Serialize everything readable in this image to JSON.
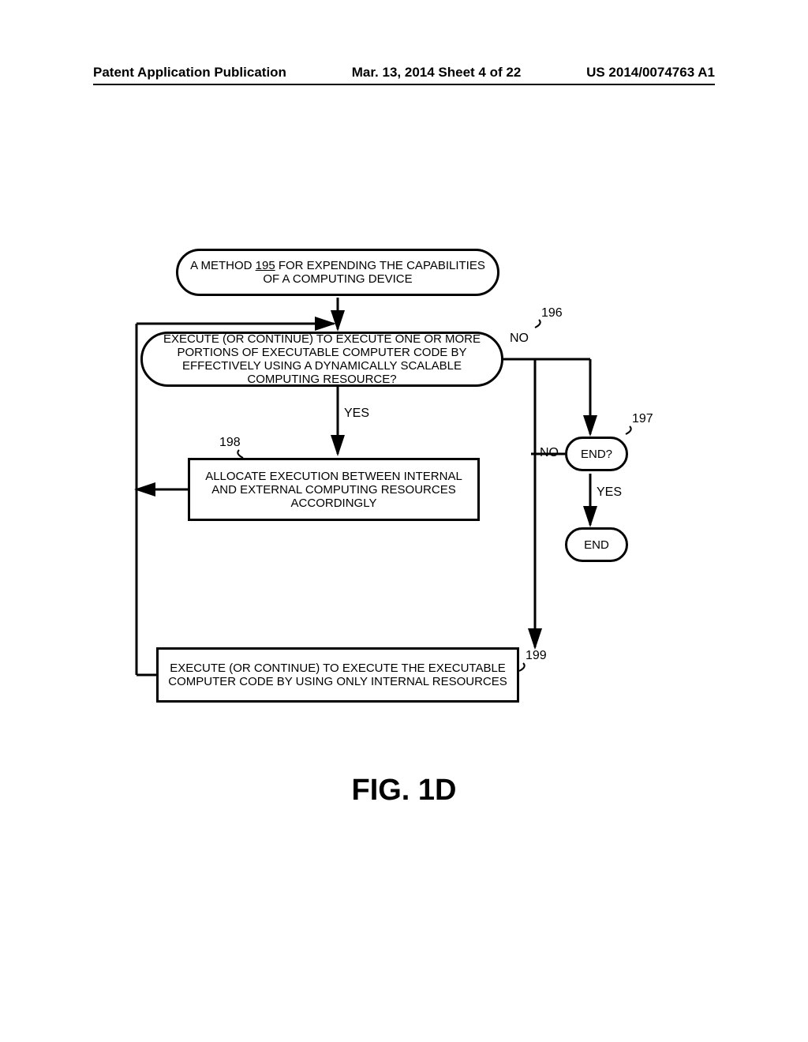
{
  "header": {
    "left": "Patent Application Publication",
    "center": "Mar. 13, 2014  Sheet 4 of 22",
    "right": "US 2014/0074763 A1"
  },
  "nodes": {
    "start_prefix": "A METHOD ",
    "start_ref": "195",
    "start_suffix": " FOR EXPENDING THE CAPABILITIES OF A COMPUTING DEVICE",
    "decision196": "EXECUTE (OR CONTINUE) TO EXECUTE ONE OR MORE PORTIONS OF EXECUTABLE COMPUTER CODE BY EFFECTIVELY USING A DYNAMICALLY SCALABLE COMPUTING RESOURCE?",
    "decision197": "END?",
    "process198": "ALLOCATE EXECUTION BETWEEN INTERNAL AND EXTERNAL COMPUTING RESOURCES ACCORDINGLY",
    "process199": "EXECUTE (OR CONTINUE) TO EXECUTE THE EXECUTABLE COMPUTER CODE BY USING ONLY INTERNAL RESOURCES",
    "end": "END"
  },
  "labels": {
    "yes196": "YES",
    "no196": "NO",
    "yes197": "YES",
    "no197": "NO",
    "ref196": "196",
    "ref197": "197",
    "ref198": "198",
    "ref199": "199"
  },
  "figure": "FIG. 1D"
}
